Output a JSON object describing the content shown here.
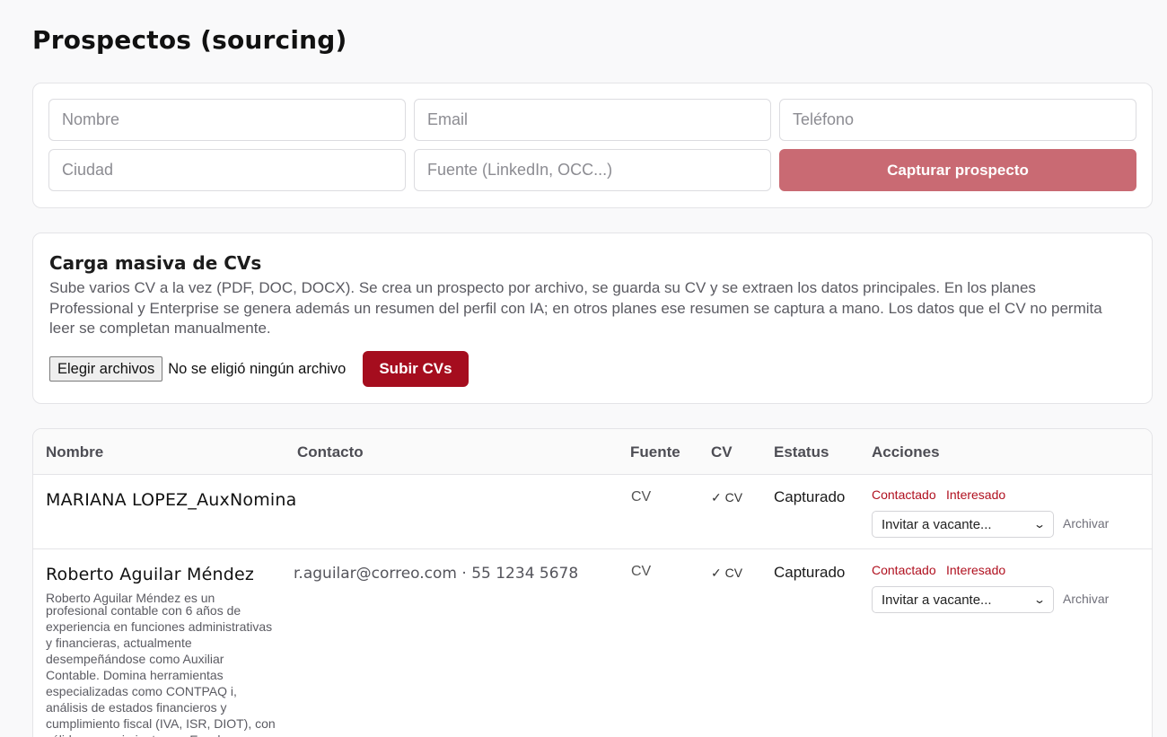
{
  "page": {
    "title": "Prospectos (sourcing)"
  },
  "capture_form": {
    "name_placeholder": "Nombre",
    "email_placeholder": "Email",
    "phone_placeholder": "Teléfono",
    "city_placeholder": "Ciudad",
    "source_placeholder": "Fuente (LinkedIn, OCC...)",
    "submit_label": "Capturar prospecto"
  },
  "bulk_upload": {
    "title": "Carga masiva de CVs",
    "description": "Sube varios CV a la vez (PDF, DOC, DOCX). Se crea un prospecto por archivo, se guarda su CV y se extraen los datos principales. En los planes Professional y Enterprise se genera además un resumen del perfil con IA; en otros planes ese resumen se captura a mano. Los datos que el CV no permita leer se completan manualmente.",
    "file_button_label": "Elegir archivos",
    "file_status": "No se eligió ningún archivo",
    "upload_label": "Subir CVs"
  },
  "table": {
    "headers": {
      "name": "Nombre",
      "contact": "Contacto",
      "source": "Fuente",
      "cv": "CV",
      "status": "Estatus",
      "actions": "Acciones"
    },
    "rows": [
      {
        "name": "MARIANA LOPEZ_AuxNomina",
        "summary": "",
        "contact": "",
        "source": "CV",
        "cv": "✓ CV",
        "status": "Capturado",
        "action_contacted": "Contactado",
        "action_interested": "Interesado",
        "invite_select": "Invitar a vacante...",
        "archive": "Archivar"
      },
      {
        "name": "Roberto Aguilar Méndez",
        "summary_first": "Roberto Aguilar Méndez es un",
        "summary": "profesional contable con 6 años de experiencia en funciones administrativas y financieras, actualmente desempeñándose como Auxiliar Contable. Domina herramientas especializadas como CONTPAQ i, análisis de estados financieros y cumplimiento fiscal (IVA, ISR, DIOT), con sólidos conocimientos en Excel y",
        "contact": "r.aguilar@correo.com · 55 1234 5678",
        "source": "CV",
        "cv": "✓ CV",
        "status": "Capturado",
        "action_contacted": "Contactado",
        "action_interested": "Interesado",
        "invite_select": "Invitar a vacante...",
        "archive": "Archivar"
      }
    ]
  },
  "colors": {
    "accent": "#a50d1e",
    "accent_muted": "#c96a73",
    "link": "#b0101f"
  }
}
